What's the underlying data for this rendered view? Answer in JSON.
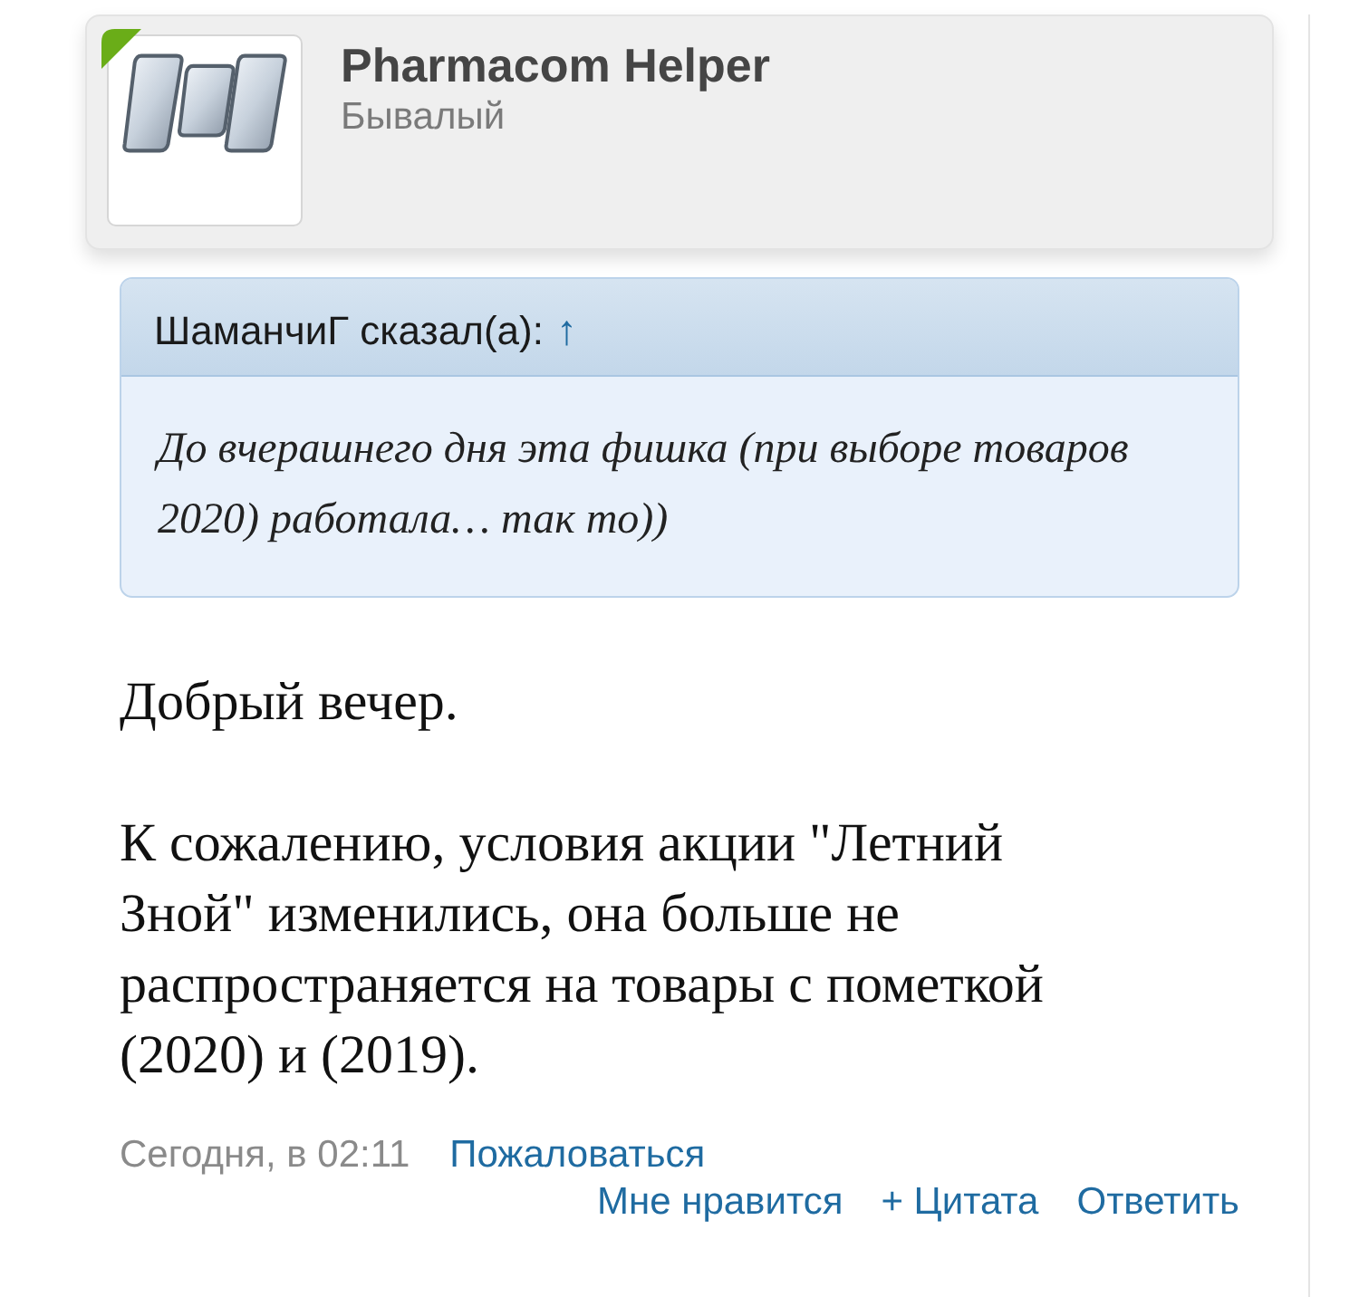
{
  "author": {
    "name": "Pharmacom Helper",
    "rank": "Бывалый",
    "online": true
  },
  "quote": {
    "attribution": "ШаманчиГ сказал(а):",
    "jump_link": "↑",
    "text": "До вчерашнего дня эта фишка (при выборе товаров 2020) работала… так то))"
  },
  "message": {
    "paragraphs": [
      "Добрый вечер.",
      "К сожалению, условия акции \"Летний Зной\" изменились, она больше не распространяется на товары с пометкой (2020) и (2019)."
    ]
  },
  "footer": {
    "timestamp": "Сегодня, в 02:11",
    "report_link": "Пожаловаться",
    "actions": [
      "Мне нравится",
      "+ Цитата",
      "Ответить"
    ]
  }
}
